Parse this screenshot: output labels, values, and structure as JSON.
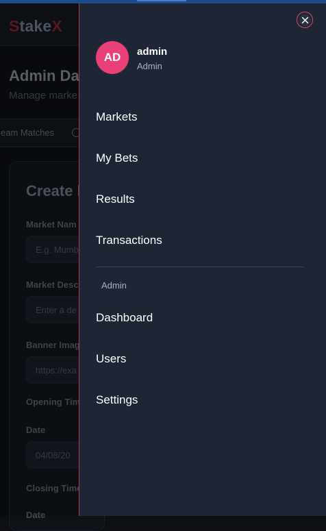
{
  "background": {
    "brand": {
      "part1": "S",
      "part2": "take",
      "part3": "X"
    },
    "page_title": "Admin Da",
    "page_subtitle": "Manage marke",
    "tab_label": "eam Matches",
    "card": {
      "title": "Create M",
      "fields": [
        {
          "label": "Market Nam",
          "placeholder": "E.g. Mumb"
        },
        {
          "label": "Market Desc",
          "placeholder": "Enter a de"
        },
        {
          "label": "Banner Imag",
          "placeholder": "https://exa"
        }
      ],
      "opening_time_label": "Opening Tim",
      "opening_date_label": "Date",
      "opening_date_value": "04/08/20",
      "closing_time_label": "Closing Time",
      "closing_date_label": "Date"
    }
  },
  "drawer": {
    "close_icon": "close-icon",
    "user": {
      "initials": "AD",
      "name": "admin",
      "role": "Admin"
    },
    "nav": [
      {
        "label": "Markets"
      },
      {
        "label": "My Bets"
      },
      {
        "label": "Results"
      },
      {
        "label": "Transactions"
      }
    ],
    "admin_section_label": "Admin",
    "admin_nav": [
      {
        "label": "Dashboard"
      },
      {
        "label": "Users"
      },
      {
        "label": "Settings"
      }
    ]
  },
  "colors": {
    "drawer_bg": "#1e2535",
    "accent": "#e8417a",
    "close_ring": "#e0436b",
    "brand_red": "#6a1a2c"
  }
}
